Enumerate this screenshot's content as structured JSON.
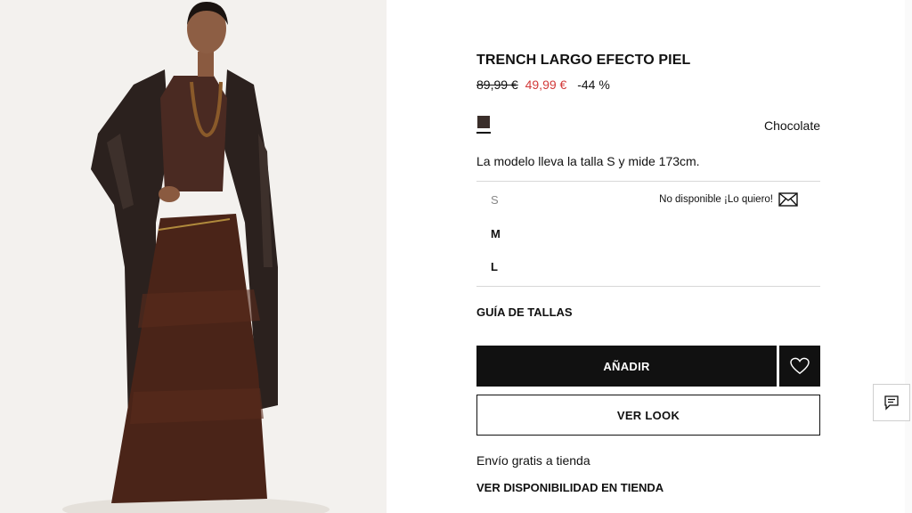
{
  "product": {
    "title": "TRENCH LARGO EFECTO PIEL",
    "old_price": "89,99 €",
    "new_price": "49,99 €",
    "discount": "-44 %",
    "color_name": "Chocolate",
    "swatch_color": "#3a2e2a",
    "model_info": "La modelo lleva la talla S y mide 173cm."
  },
  "sizes": [
    {
      "label": "S",
      "available": false,
      "notify_label": "No disponible ¡Lo quiero!",
      "notify_icon": "envelope-icon"
    },
    {
      "label": "M",
      "available": true
    },
    {
      "label": "L",
      "available": true
    }
  ],
  "actions": {
    "size_guide": "GUÍA DE TALLAS",
    "add_label": "AÑADIR",
    "wishlist_icon": "heart-icon",
    "look_label": "VER LOOK",
    "shipping": "Envío gratis a tienda",
    "availability": "VER DISPONIBILIDAD EN TIENDA"
  },
  "chat": {
    "icon": "chat-icon"
  },
  "colors": {
    "sale": "#d23a3a",
    "button_bg": "#111111",
    "divider": "#d8d8d8"
  }
}
